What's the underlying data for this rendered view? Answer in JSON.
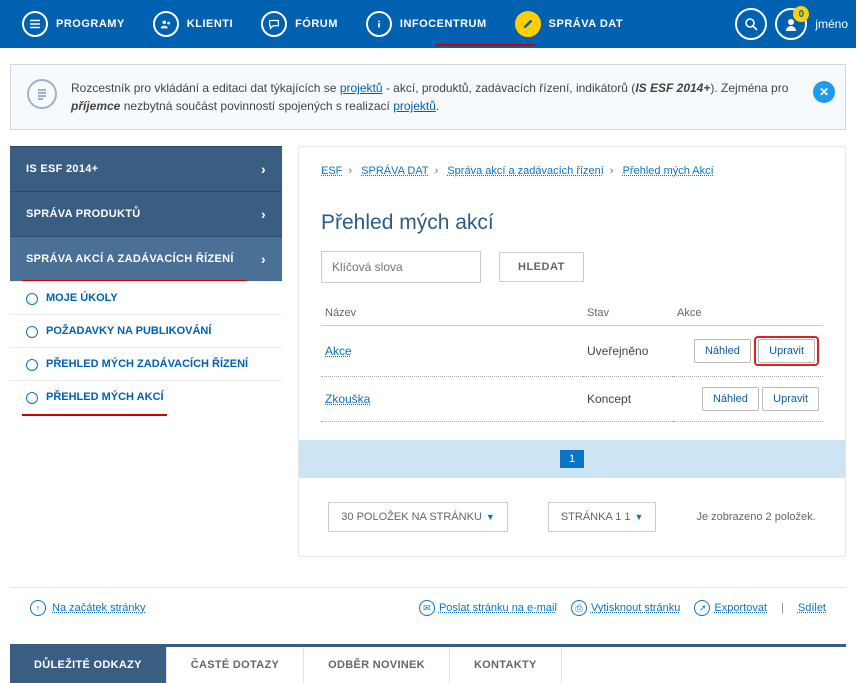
{
  "topnav": {
    "items": [
      {
        "label": "PROGRAMY"
      },
      {
        "label": "KLIENTI"
      },
      {
        "label": "FÓRUM"
      },
      {
        "label": "INFOCENTRUM"
      },
      {
        "label": "SPRÁVA DAT"
      }
    ],
    "user": "jméno",
    "badge": "0"
  },
  "banner": {
    "text_pre": "Rozcestník pro vkládání a editaci dat týkajících se ",
    "link1": "projektů",
    "text_mid": " - akcí, produktů, zadávacích řízení, indikátorů (",
    "em1": "IS ESF 2014+",
    "text_mid2": "). Zejména pro ",
    "em2": "příjemce",
    "text_post": " nezbytná součást povinností spojených s realizací ",
    "link2": "projektů",
    "text_end": "."
  },
  "sidebar": {
    "groups": [
      {
        "label": "IS ESF 2014+"
      },
      {
        "label": "SPRÁVA PRODUKTŮ"
      },
      {
        "label": "SPRÁVA AKCÍ A ZADÁVACÍCH ŘÍZENÍ"
      }
    ],
    "sub": [
      {
        "label": "MOJE ÚKOLY"
      },
      {
        "label": "POŽADAVKY NA PUBLIKOVÁNÍ"
      },
      {
        "label": "PŘEHLED MÝCH ZADÁVACÍCH ŘÍZENÍ"
      },
      {
        "label": "PŘEHLED MÝCH AKCÍ"
      }
    ]
  },
  "breadcrumb": [
    "ESF",
    "SPRÁVA DAT",
    "Správa akcí a zadávacích řízení",
    "Přehled mých Akcí"
  ],
  "page": {
    "title": "Přehled mých akcí",
    "search_placeholder": "Klíčová slova",
    "search_btn": "HLEDAT"
  },
  "table": {
    "cols": [
      "Název",
      "Stav",
      "Akce"
    ],
    "rows": [
      {
        "name": "Akce",
        "stav": "Uveřejněno",
        "a1": "Náhled",
        "a2": "Upravit"
      },
      {
        "name": "Zkouška",
        "stav": "Koncept",
        "a1": "Náhled",
        "a2": "Upravit"
      }
    ]
  },
  "pager": {
    "current": "1",
    "per_page": "30 POLOŽEK NA STRÁNKU",
    "page_label": "STRÁNKA 1   1",
    "summary": "Je zobrazeno 2 položek."
  },
  "footer": {
    "top": "Na začátek stránky",
    "email": "Poslat stránku na e-mail",
    "print": "Vytisknout stránku",
    "export": "Exportovat",
    "share": "Sdílet"
  },
  "bottom_tabs": [
    "DŮLEŽITÉ ODKAZY",
    "ČASTÉ DOTAZY",
    "ODBĚR NOVINEK",
    "KONTAKTY"
  ]
}
